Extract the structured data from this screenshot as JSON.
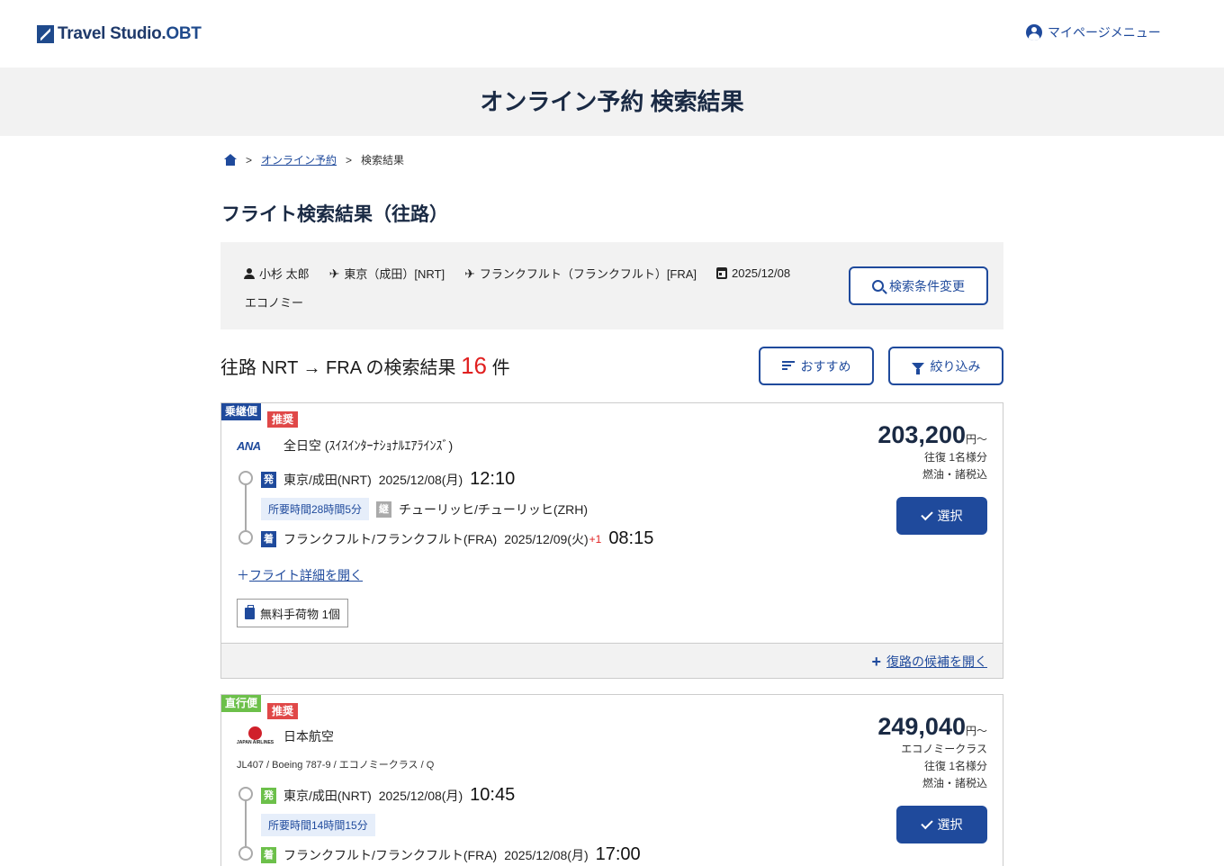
{
  "header": {
    "logo_text": "Travel Studio",
    "logo_suffix": "OBT",
    "mypage_label": "マイページメニュー"
  },
  "page_title": "オンライン予約 検索結果",
  "breadcrumb": {
    "link": "オンライン予約",
    "current": "検索結果",
    "sep": ">"
  },
  "section_title": "フライト検索結果（往路）",
  "search_summary": {
    "traveler": "小杉 太郎",
    "departure": "東京（成田）[NRT]",
    "arrival": "フランクフルト（フランクフルト）[FRA]",
    "date": "2025/12/08",
    "cabin": "エコノミー",
    "modify_button": "検索条件変更"
  },
  "results": {
    "prefix": "往路 NRT → FRA の検索結果",
    "count": "16",
    "suffix": "件",
    "sort_button": "おすすめ",
    "filter_button": "絞り込み"
  },
  "flights": [
    {
      "type_tag": "乗継便",
      "rec_tag": "推奨",
      "logo": "ANA",
      "airline": "全日空 (ｽｲｽｲﾝﾀｰﾅｼｮﾅﾙｴｱﾗｲﾝｽﾞ)",
      "dep_badge": "発",
      "dep_place": "東京/成田(NRT)",
      "dep_date": "2025/12/08(月)",
      "dep_time": "12:10",
      "duration": "所要時間28時間5分",
      "via_badge": "継",
      "via_place": "チューリッヒ/チューリッヒ(ZRH)",
      "arr_badge": "着",
      "arr_place": "フランクフルト/フランクフルト(FRA)",
      "arr_date": "2025/12/09(火)",
      "arr_plus": "+1",
      "arr_time": "08:15",
      "detail_link": "フライト詳細を開く",
      "baggage": "無料手荷物 1個",
      "price": "203,200",
      "price_unit": "円～",
      "note1": "往復 1名様分",
      "note2": "燃油・諸税込",
      "select": "選択",
      "return_link": "復路の候補を開く"
    },
    {
      "type_tag": "直行便",
      "rec_tag": "推奨",
      "airline": "日本航空",
      "meta": "JL407 / Boeing 787-9 / エコノミークラス / Q",
      "dep_badge": "発",
      "dep_place": "東京/成田(NRT)",
      "dep_date": "2025/12/08(月)",
      "dep_time": "10:45",
      "duration": "所要時間14時間15分",
      "arr_badge": "着",
      "arr_place": "フランクフルト/フランクフルト(FRA)",
      "arr_date": "2025/12/08(月)",
      "arr_time": "17:00",
      "price": "249,040",
      "price_unit": "円～",
      "note0": "エコノミークラス",
      "note1": "往復 1名様分",
      "note2": "燃油・諸税込",
      "select": "選択"
    }
  ]
}
